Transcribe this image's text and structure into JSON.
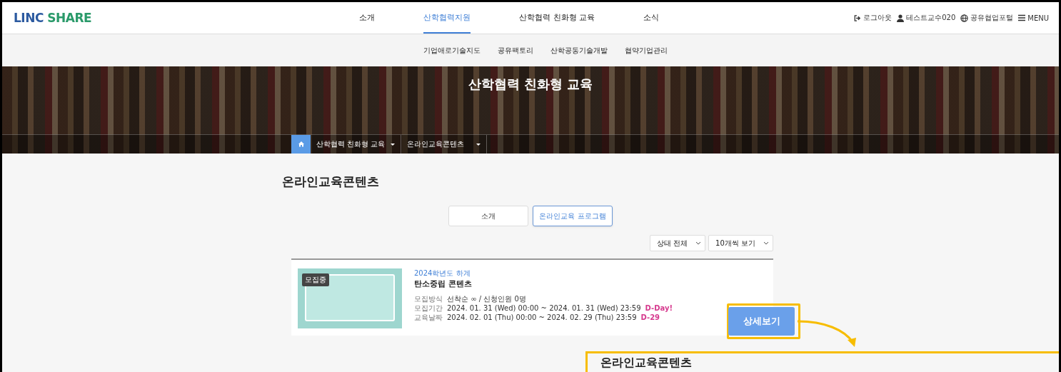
{
  "header": {
    "logo": {
      "part_1": "LINC",
      "part_2": "SHARE"
    },
    "nav": [
      {
        "label": "소개",
        "selected": false
      },
      {
        "label": "산학협력지원",
        "selected": true
      },
      {
        "label": "산학협력 친화형 교육",
        "selected": false
      },
      {
        "label": "소식",
        "selected": false
      }
    ],
    "user_links": [
      {
        "kind": "logout",
        "label": "로그아웃"
      },
      {
        "kind": "user",
        "label": "테스트교수020"
      },
      {
        "kind": "portal",
        "label": "공유협업포털"
      },
      {
        "kind": "menu",
        "label": "MENU"
      }
    ]
  },
  "subnav": [
    "기업애로기술지도",
    "공유팩토리",
    "산학공동기술개발",
    "협약기업관리"
  ],
  "hero": {
    "title": "산학협력 친화형 교육",
    "breadcrumb": [
      "산학협력 친화형 교육",
      "온라인교육콘텐츠"
    ]
  },
  "page_title": "온라인교육콘텐츠",
  "tabs": [
    {
      "label": "소개",
      "selected": false
    },
    {
      "label": "온라인교육 프로그램",
      "selected": true
    }
  ],
  "filters": [
    "상태 전체",
    "10개씩 보기"
  ],
  "programs": [
    {
      "badge": "모집중",
      "term": "2024학년도 하계",
      "title": "탄소중립 콘텐츠",
      "details": [
        {
          "label": "모집방식",
          "value": "선착순 ∞ / 신청인원 0명"
        },
        {
          "label": "모집기간",
          "value": "2024. 01. 31 (Wed) 00:00 ~ 2024. 01. 31 (Wed) 23:59",
          "dday": "D-Day!"
        },
        {
          "label": "교육날짜",
          "value": "2024. 02. 01 (Thu) 00:00 ~ 2024. 02. 29 (Thu) 23:59",
          "dday": "D-29"
        }
      ],
      "button": "상세보기",
      "highlighted": true
    }
  ],
  "callout": {
    "title": "온라인교육콘텐츠"
  }
}
